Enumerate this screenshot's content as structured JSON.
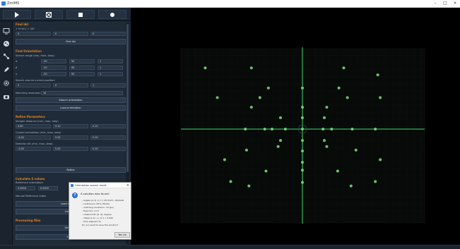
{
  "window": {
    "title": "ZmIMS"
  },
  "toolbar": {
    "play": "play-icon",
    "grid": "grid-icon",
    "stop": "stop-icon",
    "record": "record-icon"
  },
  "sidebar": {
    "icons": [
      "monitor-icon",
      "palette-icon",
      "molecule-icon",
      "edit-icon",
      "settings-icon",
      "camera-icon"
    ]
  },
  "panel": {
    "hkl": {
      "title": "Find hkl",
      "subtitle": "+ h'hkl [ + hkl'",
      "fields": [
        "0",
        "0",
        "0"
      ],
      "button": "Find hkl"
    },
    "orientation": {
      "title": "Find Orientation",
      "range_label": "Search range (min, max, step)",
      "rows": [
        [
          "α",
          "-20",
          "90",
          "1"
        ],
        [
          "β",
          "-20",
          "90",
          "1"
        ],
        [
          "γ",
          "-20",
          "90",
          "1"
        ]
      ],
      "current_label": "Search around current position",
      "current": [
        "0",
        "0",
        "1"
      ],
      "matching_label": "Matching resolution",
      "matching_value": "10",
      "search_button": "Search orientation",
      "load_button": "Load orientation"
    },
    "refine": {
      "title": "Refine Parameters",
      "sample_label": "Sample distance (min, max, step)",
      "sample": [
        "4.90",
        "5.10",
        "0.10"
      ],
      "crystal_label": "Crystal orientation (min, max, step)",
      "crystal": [
        "-5.00",
        "5.00",
        "0.10"
      ],
      "detector_label": "Detector tilt (min, max, step)",
      "detector": [
        "-5.00",
        "5.00",
        "0.10"
      ],
      "refine_button": "Refine"
    },
    "calc": {
      "title": "Calculate S values",
      "ref_label": "Reference orientation",
      "ref": [
        "0.0000",
        "0.0000"
      ],
      "manual_label": "Manual Reference index",
      "load_button": "Load Reference",
      "calc_button": "Calculate"
    },
    "process": {
      "title": "Processing files",
      "select_a": "Select dir",
      "select_b": "Select"
    }
  },
  "dialog": {
    "title": "Orientation search result",
    "heading": "A solution was found:",
    "lines": [
      "- angles (α, β, γ) = (-45.2123, -48.0036",
      "- confidence: 95% (36/32)",
      "- matching resolution: 10 (px)",
      "- fixed hkl: [ 0 0",
      "- rotation/hkl: [0, 0]: degree",
      "- distance to: +/- 0.1 + 5.000",
      "- time elapsed: 5s",
      "Do you want to save the solution?"
    ],
    "yes_button": "Yes (la"
  },
  "colors": {
    "accent": "#e8821e",
    "spot": "#7fe27f",
    "axis": "#3fd97a",
    "panel": "#1f2b38"
  },
  "spots": [
    [
      -0.8,
      -0.7
    ],
    [
      -0.42,
      -0.7
    ],
    [
      0.34,
      -0.7
    ],
    [
      0.62,
      -0.62
    ],
    [
      -0.28,
      -0.47
    ],
    [
      0.0,
      -0.47
    ],
    [
      0.3,
      -0.47
    ],
    [
      -0.7,
      -0.36
    ],
    [
      -0.35,
      -0.36
    ],
    [
      0.37,
      -0.36
    ],
    [
      0.64,
      -0.36
    ],
    [
      -0.42,
      -0.25
    ],
    [
      0.0,
      -0.25
    ],
    [
      0.2,
      -0.25
    ],
    [
      -0.18,
      -0.13
    ],
    [
      0.0,
      -0.13
    ],
    [
      0.18,
      -0.13
    ],
    [
      -0.47,
      0.0
    ],
    [
      -0.31,
      0.0
    ],
    [
      -0.25,
      0.0
    ],
    [
      -0.14,
      0.0
    ],
    [
      0.0,
      0.0
    ],
    [
      0.17,
      0.0
    ],
    [
      0.24,
      0.0
    ],
    [
      0.41,
      0.0
    ],
    [
      0.6,
      0.0
    ],
    [
      -0.18,
      0.13
    ],
    [
      0.0,
      0.13
    ],
    [
      0.18,
      0.13
    ],
    [
      -0.46,
      0.24
    ],
    [
      -0.2,
      0.2
    ],
    [
      0.0,
      0.25
    ],
    [
      0.2,
      0.2
    ],
    [
      0.44,
      0.24
    ],
    [
      -0.64,
      0.35
    ],
    [
      0.64,
      0.35
    ],
    [
      0.0,
      0.38
    ],
    [
      -0.3,
      0.48
    ],
    [
      0.0,
      0.47
    ],
    [
      0.29,
      0.48
    ],
    [
      -0.59,
      0.6
    ],
    [
      -0.44,
      0.65
    ],
    [
      0.0,
      0.61
    ],
    [
      0.4,
      0.65
    ],
    [
      0.6,
      0.6
    ]
  ]
}
